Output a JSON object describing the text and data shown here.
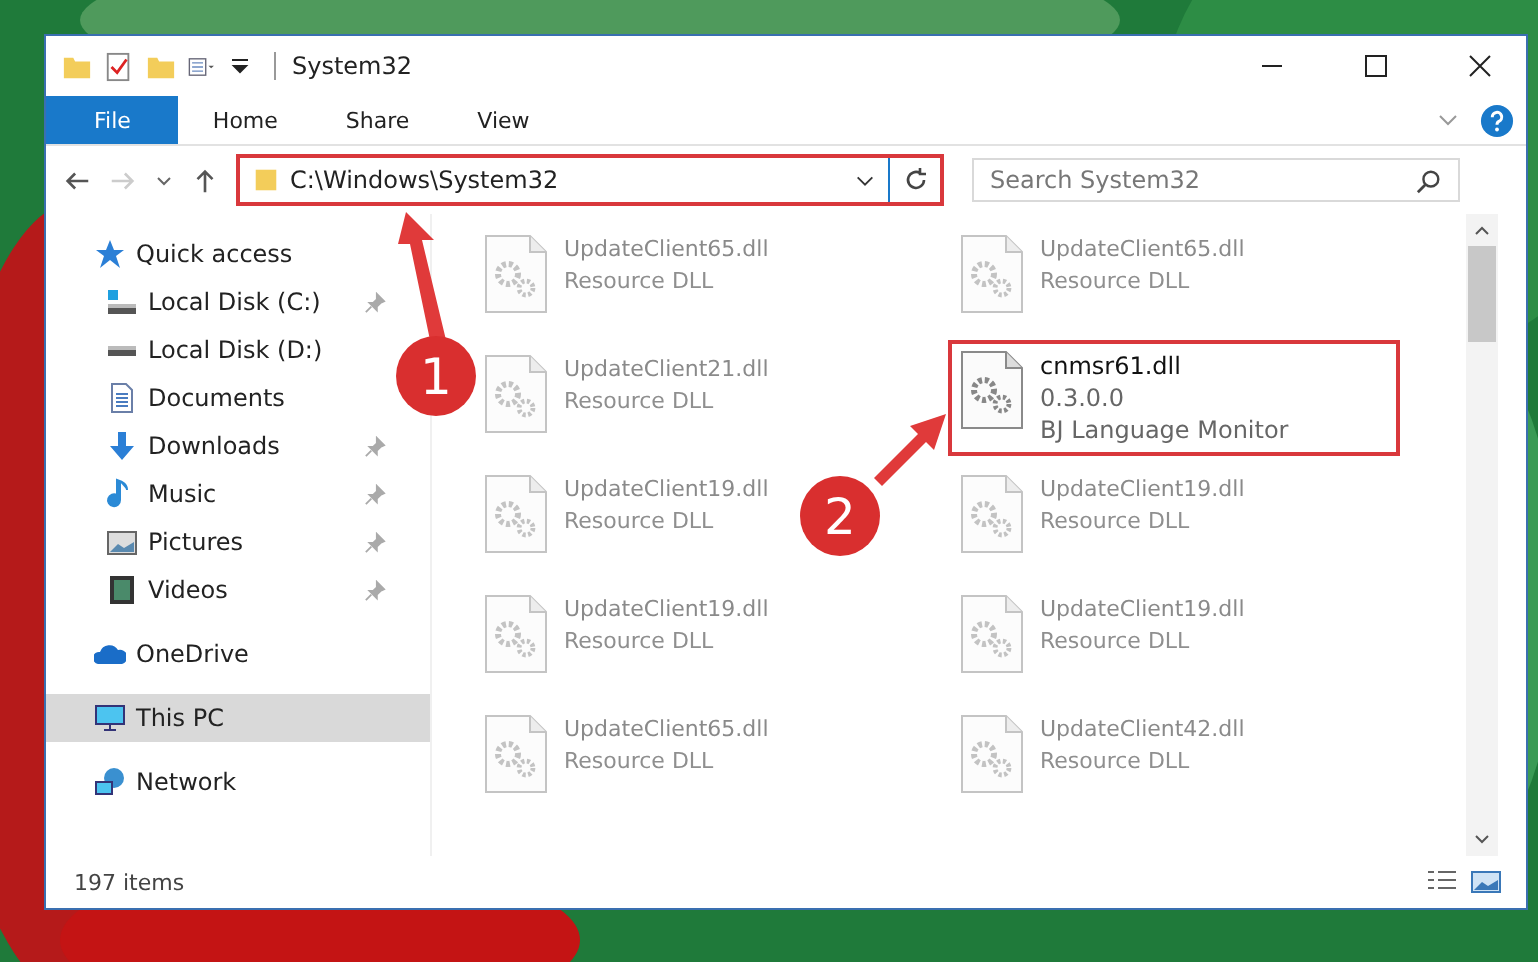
{
  "window": {
    "title": "System32"
  },
  "ribbon_tabs": [
    {
      "label": "File",
      "selected": true
    },
    {
      "label": "Home",
      "selected": false
    },
    {
      "label": "Share",
      "selected": false
    },
    {
      "label": "View",
      "selected": false
    }
  ],
  "address": {
    "path": "C:\\Windows\\System32",
    "highlighted": true
  },
  "search": {
    "placeholder": "Search System32"
  },
  "sidebar": {
    "items": [
      {
        "label": "Quick access",
        "kind": "quick",
        "selected": false,
        "children": [
          {
            "label": "Local Disk (C:)",
            "kind": "diskc",
            "selected": false,
            "pinned": true
          },
          {
            "label": "Local Disk (D:)",
            "kind": "disk",
            "selected": false,
            "pinned": false
          },
          {
            "label": "Documents",
            "kind": "documents",
            "selected": false,
            "pinned": false
          },
          {
            "label": "Downloads",
            "kind": "downloads",
            "selected": false,
            "pinned": true
          },
          {
            "label": "Music",
            "kind": "music",
            "selected": false,
            "pinned": true
          },
          {
            "label": "Pictures",
            "kind": "pictures",
            "selected": false,
            "pinned": true
          },
          {
            "label": "Videos",
            "kind": "videos",
            "selected": false,
            "pinned": true
          }
        ]
      },
      {
        "label": "OneDrive",
        "kind": "cloud",
        "selected": false
      },
      {
        "label": "This PC",
        "kind": "pc",
        "selected": true
      },
      {
        "label": "Network",
        "kind": "network",
        "selected": false
      }
    ]
  },
  "files": [
    {
      "name": "UpdateClient65.dll",
      "details": [
        "Resource DLL"
      ],
      "highlighted": false
    },
    {
      "name": "UpdateClient65.dll",
      "details": [
        "Resource DLL"
      ],
      "highlighted": false
    },
    {
      "name": "UpdateClient21.dll",
      "details": [
        "Resource DLL"
      ],
      "highlighted": false
    },
    {
      "name": "cnmsr61.dll",
      "details": [
        "0.3.0.0",
        "BJ Language Monitor"
      ],
      "highlighted": true
    },
    {
      "name": "UpdateClient19.dll",
      "details": [
        "Resource DLL"
      ],
      "highlighted": false
    },
    {
      "name": "UpdateClient19.dll",
      "details": [
        "Resource DLL"
      ],
      "highlighted": false
    },
    {
      "name": "UpdateClient19.dll",
      "details": [
        "Resource DLL"
      ],
      "highlighted": false
    },
    {
      "name": "UpdateClient19.dll",
      "details": [
        "Resource DLL"
      ],
      "highlighted": false
    },
    {
      "name": "UpdateClient65.dll",
      "details": [
        "Resource DLL"
      ],
      "highlighted": false
    },
    {
      "name": "UpdateClient42.dll",
      "details": [
        "Resource DLL"
      ],
      "highlighted": false
    }
  ],
  "status_bar": {
    "count": "197 items"
  },
  "annotations": [
    {
      "label": "1"
    },
    {
      "label": "2"
    }
  ]
}
